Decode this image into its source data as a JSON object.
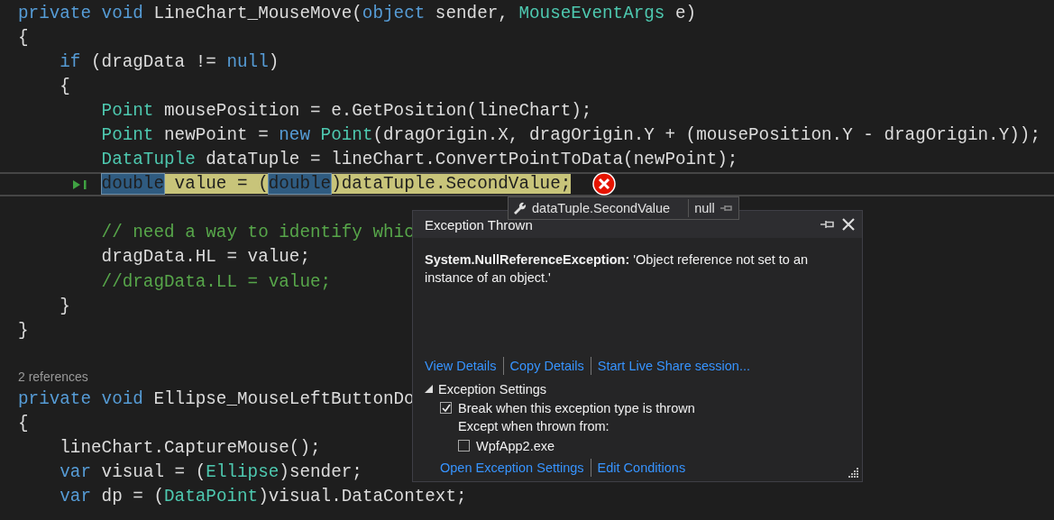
{
  "code_lines": [
    {
      "kind": "code",
      "tokens": [
        {
          "t": "private void ",
          "kind": "keyword"
        },
        {
          "t": "LineChart_MouseMove(",
          "kind": "plain"
        },
        {
          "t": "object ",
          "kind": "keyword"
        },
        {
          "t": "sender, ",
          "kind": "plain"
        },
        {
          "t": "MouseEventArgs ",
          "kind": "type"
        },
        {
          "t": "e)",
          "kind": "plain"
        }
      ]
    },
    {
      "kind": "code",
      "tokens": [
        {
          "t": "{",
          "kind": "plain"
        }
      ]
    },
    {
      "kind": "code",
      "tokens": [
        {
          "t": "    if ",
          "kind": "keyword"
        },
        {
          "t": "(dragData != ",
          "kind": "plain"
        },
        {
          "t": "null",
          "kind": "keyword"
        },
        {
          "t": ")",
          "kind": "plain"
        }
      ]
    },
    {
      "kind": "code",
      "tokens": [
        {
          "t": "    {",
          "kind": "plain"
        }
      ]
    },
    {
      "kind": "code",
      "tokens": [
        {
          "t": "        Point ",
          "kind": "type"
        },
        {
          "t": "mousePosition = e.GetPosition(lineChart);",
          "kind": "plain"
        }
      ]
    },
    {
      "kind": "code",
      "tokens": [
        {
          "t": "        Point ",
          "kind": "type"
        },
        {
          "t": "newPoint = ",
          "kind": "plain"
        },
        {
          "t": "new ",
          "kind": "keyword"
        },
        {
          "t": "Point",
          "kind": "type"
        },
        {
          "t": "(dragOrigin.X, dragOrigin.Y + (mousePosition.Y - dragOrigin.Y));",
          "kind": "plain"
        }
      ]
    },
    {
      "kind": "code",
      "tokens": [
        {
          "t": "        DataTuple ",
          "kind": "type"
        },
        {
          "t": "dataTuple = lineChart.ConvertPointToData(newPoint);",
          "kind": "plain"
        }
      ]
    },
    {
      "kind": "code",
      "current": true,
      "error": true,
      "tokens": [
        {
          "t": "        double",
          "kind": "keyword",
          "match": true
        },
        {
          "t": " value = (",
          "kind": "plain"
        },
        {
          "t": "double",
          "kind": "keyword",
          "match": true
        },
        {
          "t": ")dataTuple.SecondValue;",
          "kind": "plain"
        }
      ]
    },
    {
      "kind": "blank"
    },
    {
      "kind": "code",
      "tokens": [
        {
          "t": "        // need a way to identify whic",
          "kind": "comment"
        }
      ]
    },
    {
      "kind": "code",
      "tokens": [
        {
          "t": "        dragData.HL = value;",
          "kind": "plain"
        }
      ]
    },
    {
      "kind": "code",
      "tokens": [
        {
          "t": "        //dragData.LL = value;",
          "kind": "comment"
        }
      ]
    },
    {
      "kind": "code",
      "tokens": [
        {
          "t": "    }",
          "kind": "plain"
        }
      ]
    },
    {
      "kind": "code",
      "tokens": [
        {
          "t": "}",
          "kind": "plain"
        }
      ]
    },
    {
      "kind": "blank"
    },
    {
      "kind": "codelens",
      "text": "2 references"
    },
    {
      "kind": "code",
      "tokens": [
        {
          "t": "private void ",
          "kind": "keyword"
        },
        {
          "t": "Ellipse_MouseLeftButtonDo",
          "kind": "plain"
        }
      ]
    },
    {
      "kind": "code",
      "tokens": [
        {
          "t": "{",
          "kind": "plain"
        }
      ]
    },
    {
      "kind": "code",
      "tokens": [
        {
          "t": "    lineChart.CaptureMouse();",
          "kind": "plain"
        }
      ]
    },
    {
      "kind": "code",
      "tokens": [
        {
          "t": "    var ",
          "kind": "keyword"
        },
        {
          "t": "visual = (",
          "kind": "plain"
        },
        {
          "t": "Ellipse",
          "kind": "type"
        },
        {
          "t": ")sender;",
          "kind": "plain"
        }
      ]
    },
    {
      "kind": "code",
      "tokens": [
        {
          "t": "    var ",
          "kind": "keyword"
        },
        {
          "t": "dp = (",
          "kind": "plain"
        },
        {
          "t": "DataPoint",
          "kind": "type"
        },
        {
          "t": ")visual.DataContext;",
          "kind": "plain"
        }
      ]
    }
  ],
  "datatip": {
    "expression": "dataTuple.SecondValue",
    "value": "null"
  },
  "exception_popup": {
    "title": "Exception Thrown",
    "message": "**System.NullReferenceException:** 'Object reference not set to an instance of an object.'",
    "links": [
      "View Details",
      "Copy Details",
      "Start Live Share session..."
    ],
    "settings": {
      "label": "Exception Settings",
      "expanded": true,
      "break_option": {
        "label": "Break when this exception type is thrown",
        "checked": true
      },
      "except_label": "Except when thrown from:",
      "modules": [
        {
          "label": "WpfApp2.exe",
          "checked": false
        }
      ]
    },
    "footer_links": [
      "Open Exception Settings",
      "Edit Conditions"
    ]
  }
}
